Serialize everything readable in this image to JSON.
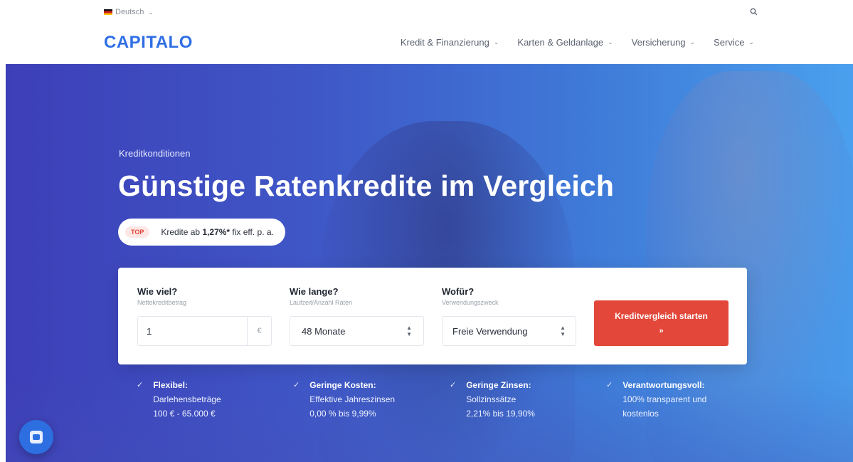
{
  "colors": {
    "brand": "#2f6fe4",
    "cta": "#e2473a",
    "hero_start": "#3d3fb8",
    "hero_end": "#4aa0ee",
    "badge_bg": "#fde7e5"
  },
  "header": {
    "language": "Deutsch",
    "language_flag_icon": "german-flag-icon",
    "search_icon": "search-icon",
    "logo": "CAPITALO",
    "nav": [
      {
        "label": "Kredit & Finanzierung"
      },
      {
        "label": "Karten & Geldanlage"
      },
      {
        "label": "Versicherung"
      },
      {
        "label": "Service"
      }
    ]
  },
  "hero": {
    "eyebrow": "Kreditkonditionen",
    "headline": "Günstige Ratenkredite im Vergleich",
    "badge": "TOP",
    "offer_prefix": "Kredite ab ",
    "offer_rate": "1,27%*",
    "offer_suffix": " fix eff. p. a."
  },
  "form": {
    "amount": {
      "label": "Wie viel?",
      "sub": "Nettokreditbetrag",
      "value": "1",
      "unit": "€"
    },
    "duration": {
      "label": "Wie lange?",
      "sub": "Laufzeit/Anzahl Raten",
      "value": "48 Monate"
    },
    "purpose": {
      "label": "Wofür?",
      "sub": "Verwendungszweck",
      "value": "Freie Verwendung"
    },
    "cta_label": "Kreditvergleich starten",
    "cta_arrow": "»"
  },
  "features": [
    {
      "title": "Flexibel:",
      "line1": "Darlehensbeträge",
      "line2": "100 € - 65.000 €"
    },
    {
      "title": "Geringe Kosten:",
      "line1": "Effektive Jahreszinsen",
      "line2": "0,00 % bis 9,99%"
    },
    {
      "title": "Geringe Zinsen:",
      "line1": "Sollzinssätze",
      "line2": "2,21% bis 19,90%"
    },
    {
      "title": "Verantwortungsvoll:",
      "line1": "100% transparent und",
      "line2": "kostenlos"
    }
  ],
  "chat_icon": "chat-icon"
}
